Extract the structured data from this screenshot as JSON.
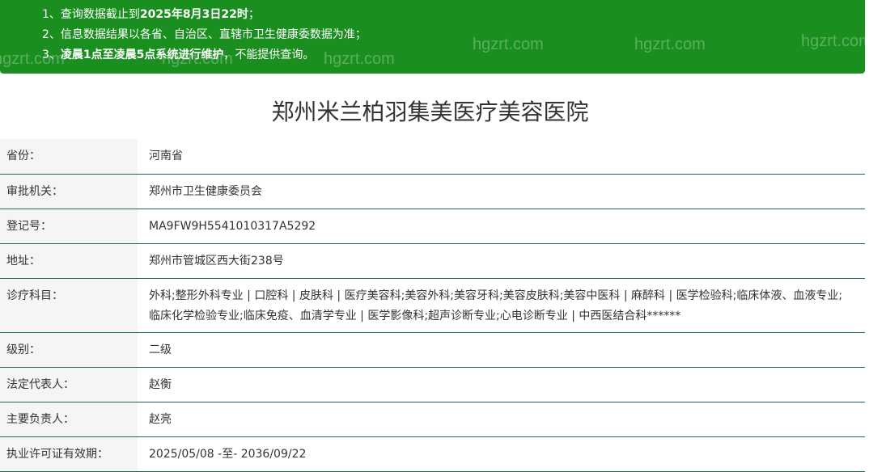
{
  "notice": {
    "lines": [
      {
        "prefix": "1、",
        "text": "查询数据截止到",
        "bold": "2025年8月3日22时",
        "suffix": "；"
      },
      {
        "prefix": "2、",
        "text": "信息数据结果以各省、自治区、直辖市卫生健康委数据为准；",
        "bold": "",
        "suffix": ""
      },
      {
        "prefix": "3、",
        "text": "",
        "bold": "凌晨1点至凌晨5点系统进行维护",
        "suffix": "，不能提供查询。"
      }
    ],
    "watermark": "hgzrt.com",
    "background_color": "#1a8f1f"
  },
  "title": "郑州米兰柏羽集美医疗美容医院",
  "fields": [
    {
      "label": "省份：",
      "value": "河南省"
    },
    {
      "label": "审批机关：",
      "value": "郑州市卫生健康委员会"
    },
    {
      "label": "登记号：",
      "value": "MA9FW9H5541010317A5292"
    },
    {
      "label": "地址：",
      "value": "郑州市管城区西大街238号"
    },
    {
      "label": "诊疗科目：",
      "value": "外科;整形外科专业 | 口腔科 | 皮肤科 | 医疗美容科;美容外科;美容牙科;美容皮肤科;美容中医科 | 麻醉科 | 医学检验科;临床体液、血液专业;临床化学检验专业;临床免疫、血清学专业 | 医学影像科;超声诊断专业;心电诊断专业 | 中西医结合科******"
    },
    {
      "label": "级别：",
      "value": "二级"
    },
    {
      "label": "法定代表人：",
      "value": "赵衡"
    },
    {
      "label": "主要负责人：",
      "value": "赵亮"
    },
    {
      "label": "执业许可证有效期：",
      "value": "2025/05/08 -至- 2036/09/22"
    }
  ]
}
